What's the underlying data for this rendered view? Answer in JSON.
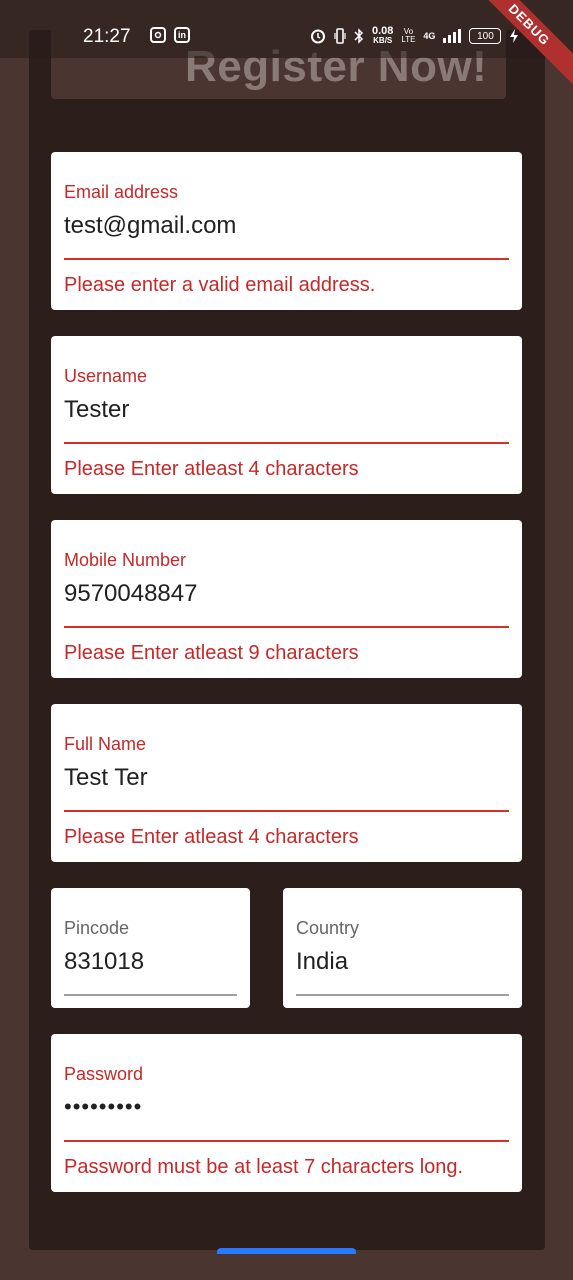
{
  "header": {
    "title": "Register Now!"
  },
  "status_bar": {
    "time": "21:27",
    "network_speed_value": "0.08",
    "network_speed_unit": "KB/S",
    "volte": "Vo LTE",
    "network_type": "4G",
    "battery": "100",
    "icons": [
      "instagram-icon",
      "linkedin-icon",
      "alarm-icon",
      "vibrate-icon",
      "bluetooth-icon",
      "signal-icon",
      "charging-icon"
    ]
  },
  "debug_banner": "DEBUG",
  "form": {
    "email": {
      "label": "Email address",
      "value": "test@gmail.com",
      "error": "Please enter a valid email address."
    },
    "username": {
      "label": "Username",
      "value": "Tester",
      "error": "Please Enter atleast 4 characters"
    },
    "mobile": {
      "label": "Mobile Number",
      "value": "9570048847",
      "error": "Please Enter atleast 9 characters"
    },
    "full_name": {
      "label": "Full Name",
      "value": "Test Ter",
      "error": "Please Enter atleast 4 characters"
    },
    "pincode": {
      "label": "Pincode",
      "value": "831018"
    },
    "country": {
      "label": "Country",
      "value": "India"
    },
    "password": {
      "label": "Password",
      "value": "•••••••••",
      "error": "Password must be at least 7 characters long."
    }
  },
  "colors": {
    "background": "#4a3530",
    "panel": "#2c1e1b",
    "error": "#c62828",
    "card": "#ffffff",
    "button_accent": "#2979ff"
  }
}
